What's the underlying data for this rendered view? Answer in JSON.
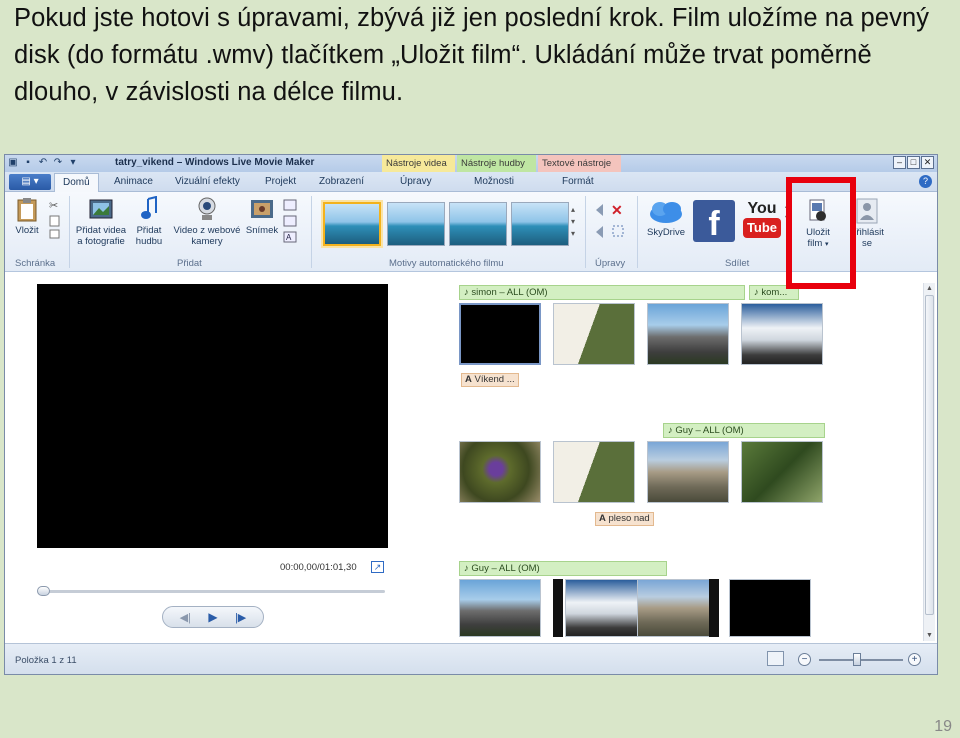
{
  "instruction": "Pokud jste hotovi s úpravami, zbývá již jen poslední krok. Film uložíme na pevný disk (do formátu .wmv) tlačítkem „Uložit film“. Ukládání může trvat poměrně dlouho, v závislosti na délce filmu.",
  "page_number": "19",
  "window": {
    "title": "tatry_vikend – Windows Live Movie Maker",
    "context_tabs": [
      "Nástroje videa",
      "Nástroje hudby",
      "Textové nástroje"
    ]
  },
  "tabs": [
    "Domů",
    "Animace",
    "Vizuální efekty",
    "Projekt",
    "Zobrazení",
    "Úpravy",
    "Možnosti",
    "Formát"
  ],
  "active_tab": "Domů",
  "ribbon": {
    "paste": "Vložit",
    "add_videos": "Přidat videa a fotografie",
    "add_music": "Přidat hudbu",
    "webcam": "Video z webové kamery",
    "snapshot": "Snímek",
    "skydrive": "SkyDrive",
    "save_movie": "Uložit film",
    "sign_in": "Přihlásit se",
    "groups": {
      "clipboard": "Schránka",
      "add": "Přidat",
      "automovie": "Motivy automatického filmu",
      "editing": "Úpravy",
      "share": "Sdílet"
    }
  },
  "preview": {
    "timecode": "00:00,00/01:01,30"
  },
  "storyboard": {
    "music_1": "simon – ALL (OM)",
    "music_1b": "kom...",
    "caption_1": "Víkend ...",
    "music_2": "Guy – ALL (OM)",
    "caption_2": "pleso nad",
    "music_3": "Guy – ALL (OM)"
  },
  "status": {
    "item": "Položka 1 z 11"
  },
  "colors": {
    "highlight": "#e8000d",
    "slide_bg": "#d9e6c9"
  }
}
